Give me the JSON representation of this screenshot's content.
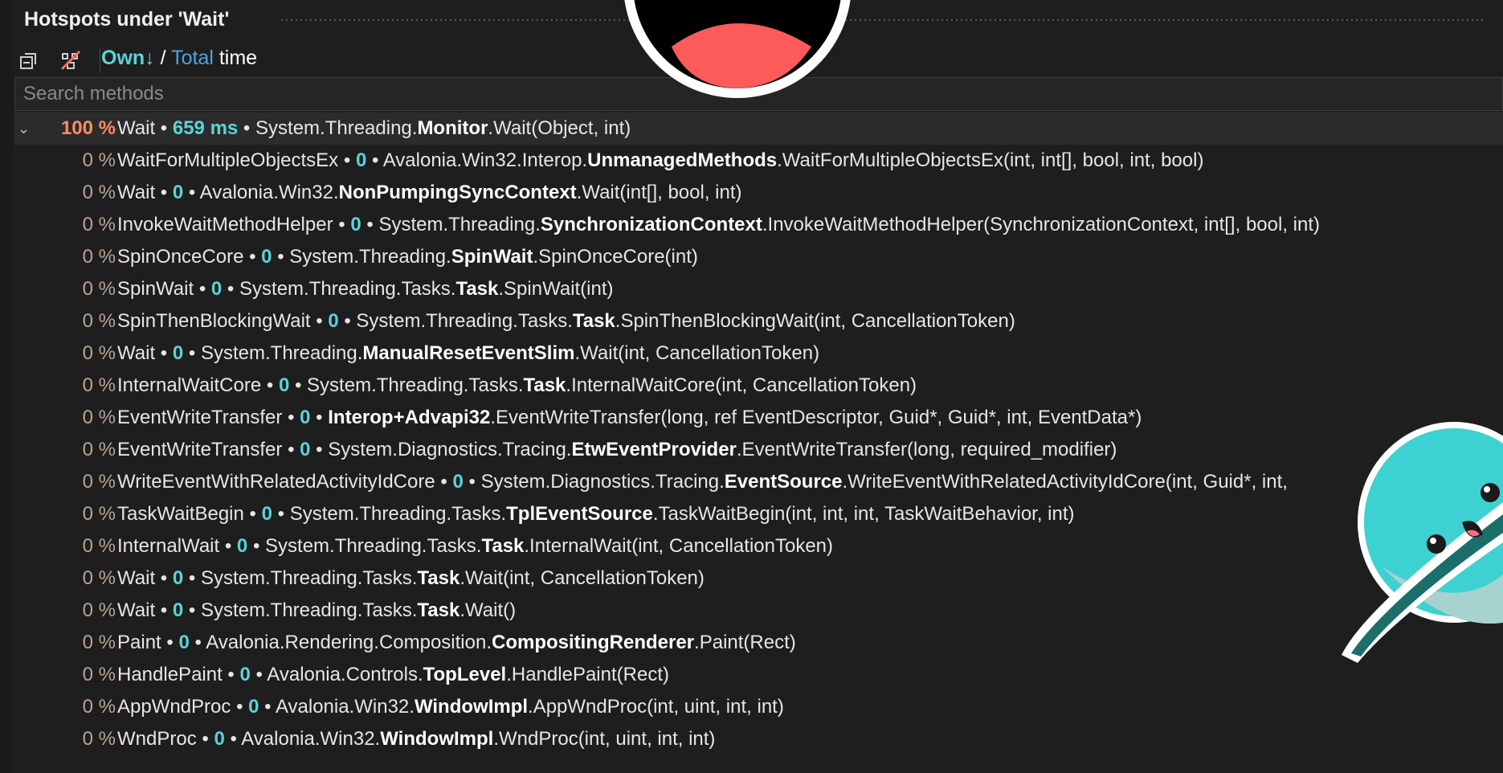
{
  "title": "Hotspots under 'Wait'",
  "toolbar": {
    "sort_own": "Own↓",
    "sort_sep": "/",
    "sort_total": "Total",
    "sort_suffix": "time"
  },
  "search": {
    "placeholder": "Search methods"
  },
  "rows": [
    {
      "pct": "100 %",
      "name": "Wait",
      "value": "659 ms",
      "ns": "System.Threading.",
      "cls": "Monitor",
      "sig": ".Wait(Object, int)"
    },
    {
      "pct": "0 %",
      "name": "WaitForMultipleObjectsEx",
      "value": "0",
      "ns": "Avalonia.Win32.Interop.",
      "cls": "UnmanagedMethods",
      "sig": ".WaitForMultipleObjectsEx(int, int[], bool, int, bool)"
    },
    {
      "pct": "0 %",
      "name": "Wait",
      "value": "0",
      "ns": "Avalonia.Win32.",
      "cls": "NonPumpingSyncContext",
      "sig": ".Wait(int[], bool, int)"
    },
    {
      "pct": "0 %",
      "name": "InvokeWaitMethodHelper",
      "value": "0",
      "ns": "System.Threading.",
      "cls": "SynchronizationContext",
      "sig": ".InvokeWaitMethodHelper(SynchronizationContext, int[], bool, int)"
    },
    {
      "pct": "0 %",
      "name": "SpinOnceCore",
      "value": "0",
      "ns": "System.Threading.",
      "cls": "SpinWait",
      "sig": ".SpinOnceCore(int)"
    },
    {
      "pct": "0 %",
      "name": "SpinWait",
      "value": "0",
      "ns": "System.Threading.Tasks.",
      "cls": "Task",
      "sig": ".SpinWait(int)"
    },
    {
      "pct": "0 %",
      "name": "SpinThenBlockingWait",
      "value": "0",
      "ns": "System.Threading.Tasks.",
      "cls": "Task",
      "sig": ".SpinThenBlockingWait(int, CancellationToken)"
    },
    {
      "pct": "0 %",
      "name": "Wait",
      "value": "0",
      "ns": "System.Threading.",
      "cls": "ManualResetEventSlim",
      "sig": ".Wait(int, CancellationToken)"
    },
    {
      "pct": "0 %",
      "name": "InternalWaitCore",
      "value": "0",
      "ns": "System.Threading.Tasks.",
      "cls": "Task",
      "sig": ".InternalWaitCore(int, CancellationToken)"
    },
    {
      "pct": "0 %",
      "name": "EventWriteTransfer",
      "value": "0",
      "ns": "",
      "cls": "Interop+Advapi32",
      "sig": ".EventWriteTransfer(long, ref EventDescriptor, Guid*, Guid*, int, EventData*)"
    },
    {
      "pct": "0 %",
      "name": "EventWriteTransfer",
      "value": "0",
      "ns": "System.Diagnostics.Tracing.",
      "cls": "EtwEventProvider",
      "sig": ".EventWriteTransfer(long, required_modifier)"
    },
    {
      "pct": "0 %",
      "name": "WriteEventWithRelatedActivityIdCore",
      "value": "0",
      "ns": "System.Diagnostics.Tracing.",
      "cls": "EventSource",
      "sig": ".WriteEventWithRelatedActivityIdCore(int, Guid*, int,"
    },
    {
      "pct": "0 %",
      "name": "TaskWaitBegin",
      "value": "0",
      "ns": "System.Threading.Tasks.",
      "cls": "TplEventSource",
      "sig": ".TaskWaitBegin(int, int, int, TaskWaitBehavior, int)"
    },
    {
      "pct": "0 %",
      "name": "InternalWait",
      "value": "0",
      "ns": "System.Threading.Tasks.",
      "cls": "Task",
      "sig": ".InternalWait(int, CancellationToken)"
    },
    {
      "pct": "0 %",
      "name": "Wait",
      "value": "0",
      "ns": "System.Threading.Tasks.",
      "cls": "Task",
      "sig": ".Wait(int, CancellationToken)"
    },
    {
      "pct": "0 %",
      "name": "Wait",
      "value": "0",
      "ns": "System.Threading.Tasks.",
      "cls": "Task",
      "sig": ".Wait()"
    },
    {
      "pct": "0 %",
      "name": "Paint",
      "value": "0",
      "ns": "Avalonia.Rendering.Composition.",
      "cls": "CompositingRenderer",
      "sig": ".Paint(Rect)"
    },
    {
      "pct": "0 %",
      "name": "HandlePaint",
      "value": "0",
      "ns": "Avalonia.Controls.",
      "cls": "TopLevel",
      "sig": ".HandlePaint(Rect)"
    },
    {
      "pct": "0 %",
      "name": "AppWndProc",
      "value": "0",
      "ns": "Avalonia.Win32.",
      "cls": "WindowImpl",
      "sig": ".AppWndProc(int, uint, int, int)"
    },
    {
      "pct": "0 %",
      "name": "WndProc",
      "value": "0",
      "ns": "Avalonia.Win32.",
      "cls": "WindowImpl",
      "sig": ".WndProc(int, uint, int, int)"
    }
  ],
  "colors": {
    "background": "#1e1e1e",
    "accent_value": "#5ad3d9",
    "hot_percent": "#ff8a65",
    "total_link": "#4ea3e0"
  }
}
